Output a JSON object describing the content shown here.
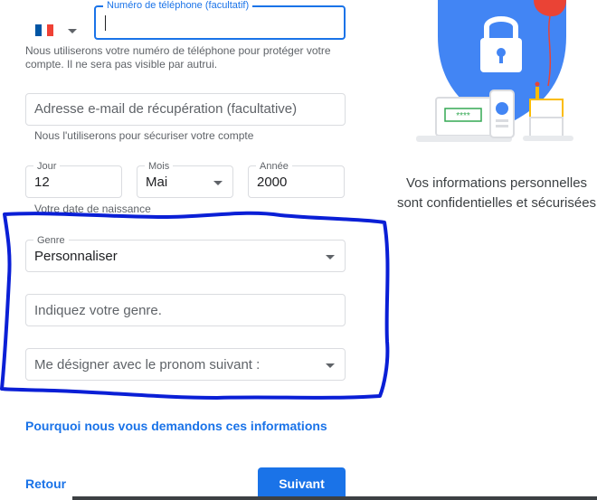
{
  "phone": {
    "country_flag": "France",
    "label": "Numéro de téléphone (facultatif)",
    "value": "",
    "helper": "Nous utiliserons votre numéro de téléphone pour protéger votre compte. Il ne sera pas visible par autrui."
  },
  "recovery_email": {
    "placeholder": "Adresse e-mail de récupération (facultative)",
    "helper": "Nous l'utiliserons pour sécuriser votre compte"
  },
  "birthdate": {
    "day_label": "Jour",
    "day_value": "12",
    "month_label": "Mois",
    "month_value": "Mai",
    "year_label": "Année",
    "year_value": "2000",
    "helper": "Votre date de naissance"
  },
  "gender": {
    "label": "Genre",
    "value": "Personnaliser",
    "custom_placeholder": "Indiquez votre genre.",
    "pronoun_placeholder": "Me désigner avec le pronom suivant :"
  },
  "why_link": "Pourquoi nous vous demandons ces informations",
  "back_button": "Retour",
  "next_button": "Suivant",
  "illustration": {
    "caption": "Vos informations personnelles sont confidentielles et sécurisées",
    "password_text": "****"
  },
  "colors": {
    "accent": "#1a73e8",
    "annotation": "#0a1fd6"
  }
}
